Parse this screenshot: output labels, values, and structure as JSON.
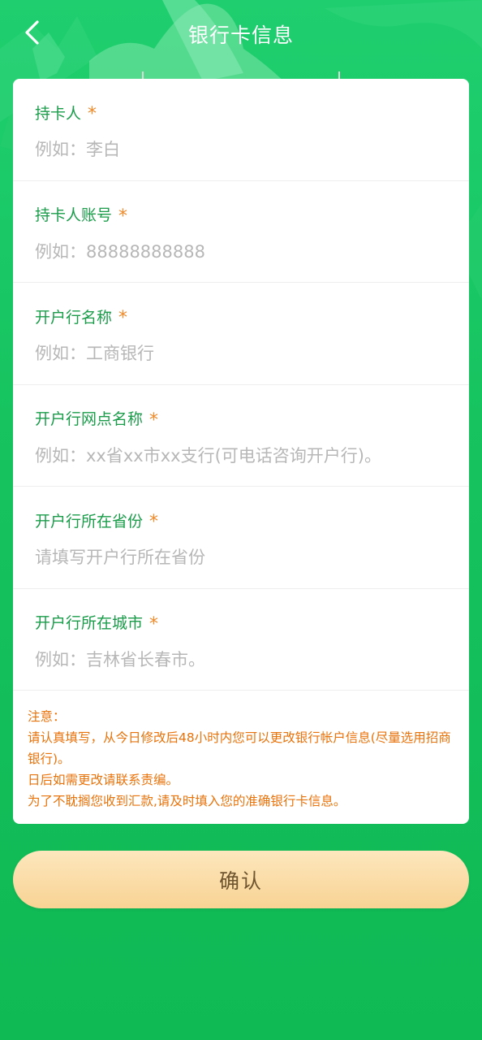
{
  "header": {
    "title": "银行卡信息",
    "back_icon": "chevron-left-icon"
  },
  "form": {
    "required_mark": "*",
    "fields": [
      {
        "label": "持卡人",
        "placeholder": "例如：李白",
        "value": ""
      },
      {
        "label": "持卡人账号",
        "placeholder": "例如：88888888888",
        "value": ""
      },
      {
        "label": "开户行名称",
        "placeholder": "例如：工商银行",
        "value": ""
      },
      {
        "label": "开户行网点名称",
        "placeholder": "例如：xx省xx市xx支行(可电话咨询开户行)。",
        "value": ""
      },
      {
        "label": "开户行所在省份",
        "placeholder": "请填写开户行所在省份",
        "value": ""
      },
      {
        "label": "开户行所在城市",
        "placeholder": "例如：吉林省长春市。",
        "value": ""
      }
    ]
  },
  "notice": {
    "heading": "注意：",
    "lines": [
      "请认真填写，从今日修改后48小时内您可以更改银行帐户信息(尽量选用招商银行)。",
      "日后如需更改请联系责编。",
      "为了不耽搁您收到汇款,请及时填入您的准确银行卡信息。"
    ]
  },
  "confirm_button": {
    "label": "确认"
  },
  "colors": {
    "background": "#16c35f",
    "label_green": "#1a9c4a",
    "required_orange": "#f08a2a",
    "notice_orange": "#e8730c",
    "button_gold": "#f8d394"
  }
}
